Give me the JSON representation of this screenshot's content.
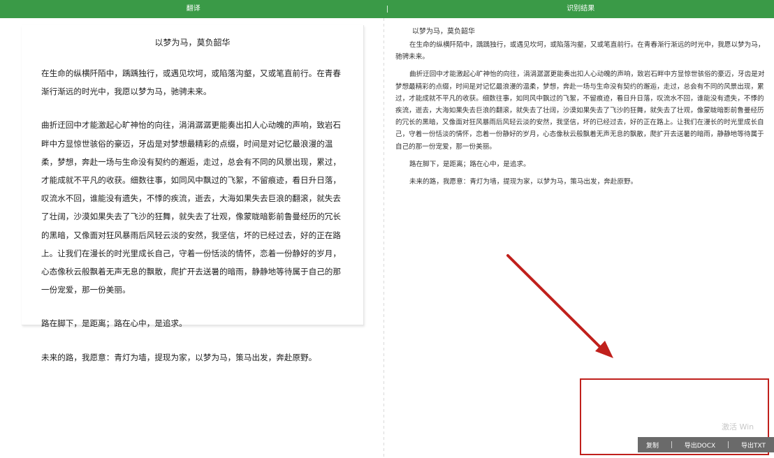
{
  "topbar": {
    "left_tab": "翻译",
    "right_tab": "识别结果"
  },
  "document": {
    "title": "以梦为马，莫负韶华",
    "paragraphs": [
      "在生命的纵横阡陌中，踽踽独行，或遇见坎坷，或陷落沟壑，又或笔直前行。在青春渐行渐远的时光中，我愿以梦为马，驰骋未来。",
      "曲折迂回中才能激起心旷神怡的向往，涓涓潺潺更能奏出扣人心动魄的声响，致岩石畔中方显惊世骇俗的豪迈，牙齿是对梦想最精彩的点缀，时间是对记忆最浪漫的温柔，梦想，奔赴一场与生命没有契约的邂逅，走过，总会有不同的风景出现，累过，才能成就不平凡的收获。细数往事，如同风中飘过的飞絮，不留痕迹，看日升日落，叹流水不回，谁能没有遗失，不悸的疾流，逝去，大海如果失去巨浪的翻滚，就失去了壮阔，沙漠如果失去了飞沙的狂舞，就失去了壮观，像蒙眬暗影前鲁曼经历的冗长的黑暗，又像面对狂风暴雨后风轻云淡的安然，我坚信，坏的已经过去，好的正在路上。让我们在漫长的时光里成长自己，守着一份恬淡的情怀，恋着一份静好的岁月，心态像秋云般飘着无声无息的飘散，爬扩开去送暑的暗雨，静静地等待属于自己的那一份宠爱，那一份美丽。",
      "路在脚下，是距离；路在心中，是追求。",
      "未来的路，我愿意：青灯为墙，提现为家，以梦为马，策马出发，奔赴原野。"
    ]
  },
  "result": {
    "title": "以梦为马，莫负韶华",
    "paragraphs": [
      "在生命的纵横阡陌中，踽踽独行，或遇见坎坷，或陷落沟壑，又或笔直前行。在青春渐行渐远的时光中，我愿以梦为马，驰骋未来。",
      "曲折迂回中才能激起心旷神怡的向往，涓涓潺潺更能奏出扣人心动魄的声响，致岩石畔中方显惊世骇俗的豪迈，牙齿是对梦想最精彩的点缀，时间是对记忆最浪漫的温柔，梦想，奔赴一场与生命没有契约的邂逅，走过，总会有不同的风景出现，累过，才能成就不平凡的收获。细数往事，如同风中飘过的飞絮，不留痕迹，看日升日落，叹流水不回，谁能没有遗失，不悸的疾流，逝去，大海如果失去巨浪的翻滚，就失去了壮阔，沙漠如果失去了飞沙的狂舞，就失去了壮观，像蒙眬暗影前鲁曼经历的冗长的黑暗，又像面对狂风暴雨后风轻云淡的安然，我坚信，坏的已经过去，好的正在路上。让我们在漫长的时光里成长自己，守着一份恬淡的情怀，恋着一份静好的岁月，心态像秋云般飘着无声无息的飘散，爬扩开去送暑的暗雨，静静地等待属于自己的那一份宠爱，那一份美丽。",
      "路在脚下，是距离；路在心中，是追求。",
      "未来的路，我愿意：青灯为墙，提现为家，以梦为马，策马出发，奔赴原野。"
    ]
  },
  "watermark": "激活 Win",
  "actions": {
    "copy": "复制",
    "export_docx": "导出DOCX",
    "export_txt": "导出TXT"
  },
  "colors": {
    "topbar": "#3a9a47",
    "highlight": "#c0201c",
    "action_bar": "#6a6a6a"
  }
}
